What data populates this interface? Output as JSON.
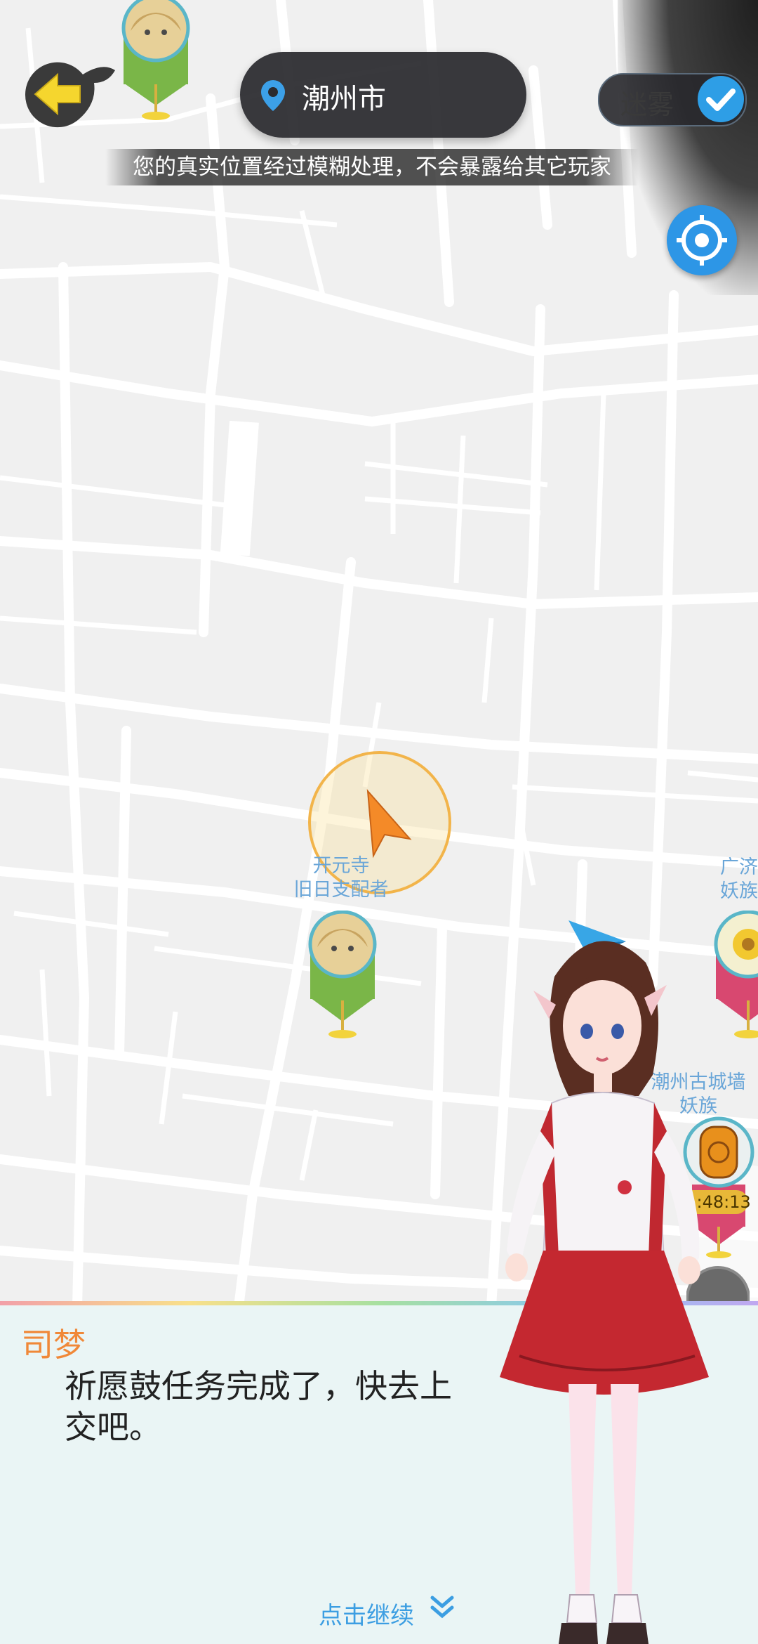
{
  "header": {
    "back_icon": "arrow-left-icon",
    "city_name": "潮州市",
    "fog_label": "迷雾",
    "fog_enabled": true,
    "notice": "您的真实位置经过模糊处理，不会暴露给其它玩家"
  },
  "map": {
    "poi_temple_name": "开元寺",
    "poi_temple_boss": "旧日支配者",
    "poi_right_top_line1": "广济",
    "poi_right_top_line2": "妖族",
    "poi_right_mid_line1": "潮州古城墙",
    "poi_right_mid_line2": "妖族",
    "timer": "01:48:13"
  },
  "dialog": {
    "speaker": "司梦",
    "text": "祈愿鼓任务完成了，快去上交吧。",
    "continue_label": "点击继续"
  },
  "colors": {
    "accent_blue": "#2e9ee6",
    "speaker_orange": "#f08838",
    "marker_green": "#7ab648",
    "marker_red": "#d84870"
  }
}
